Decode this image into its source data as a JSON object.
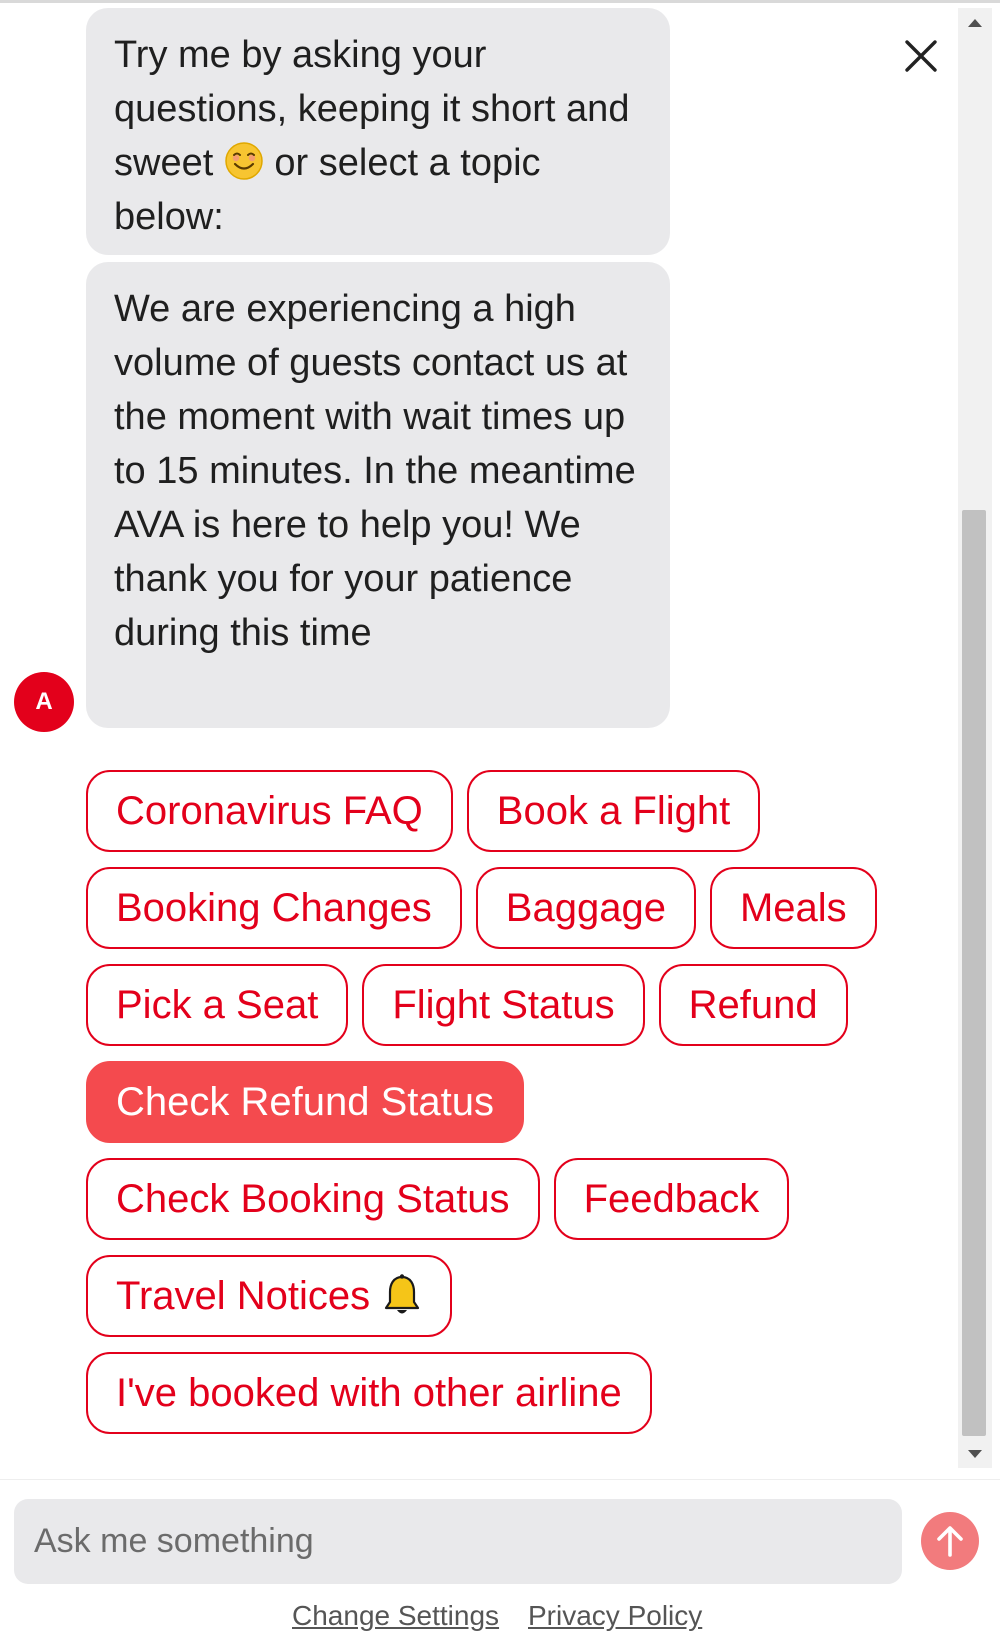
{
  "messages": {
    "intro_part1": "Try me by asking your questions, keeping it short and sweet",
    "intro_part2": " or select a topic below:",
    "notice": "We are experiencing a high volume of guests contact us at the moment with wait times up to 15 minutes. In the meantime AVA is here to help you! We thank you for your patience during this time"
  },
  "avatar": {
    "initial": "A"
  },
  "quick_replies": {
    "coronavirus_faq": "Coronavirus FAQ",
    "book_flight": "Book a Flight",
    "booking_changes": "Booking Changes",
    "baggage": "Baggage",
    "meals": "Meals",
    "pick_seat": "Pick a Seat",
    "flight_status": "Flight Status",
    "refund": "Refund",
    "check_refund_status": "Check Refund Status",
    "check_booking_status": "Check Booking Status",
    "feedback": "Feedback",
    "travel_notices": "Travel Notices",
    "other_airline": "I've booked with other airline"
  },
  "composer": {
    "placeholder": "Ask me something"
  },
  "footer": {
    "change_settings": "Change Settings",
    "privacy_policy": "Privacy Policy"
  },
  "colors": {
    "brand_red": "#e3001b",
    "active_chip": "#f44a4e",
    "send_button": "#f27b7d",
    "bubble_bg": "#e9e9eb"
  },
  "icons": {
    "close": "close-icon",
    "send": "arrow-up-icon",
    "emoji": "smiling-face-icon",
    "bell": "bell-icon"
  }
}
